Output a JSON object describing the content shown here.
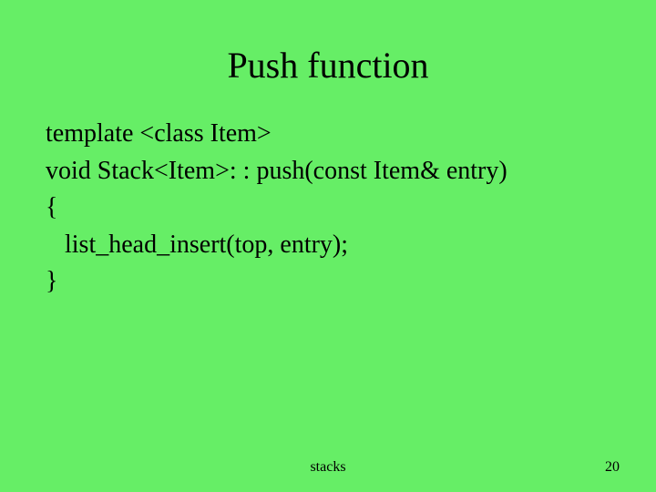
{
  "slide": {
    "title": "Push function",
    "code": {
      "line1": "template <class Item>",
      "line2": "void Stack<Item>: : push(const Item& entry)",
      "line3": "{",
      "line4": "   list_head_insert(top, entry);",
      "line5": "}"
    },
    "footer_label": "stacks",
    "page_number": "20"
  }
}
